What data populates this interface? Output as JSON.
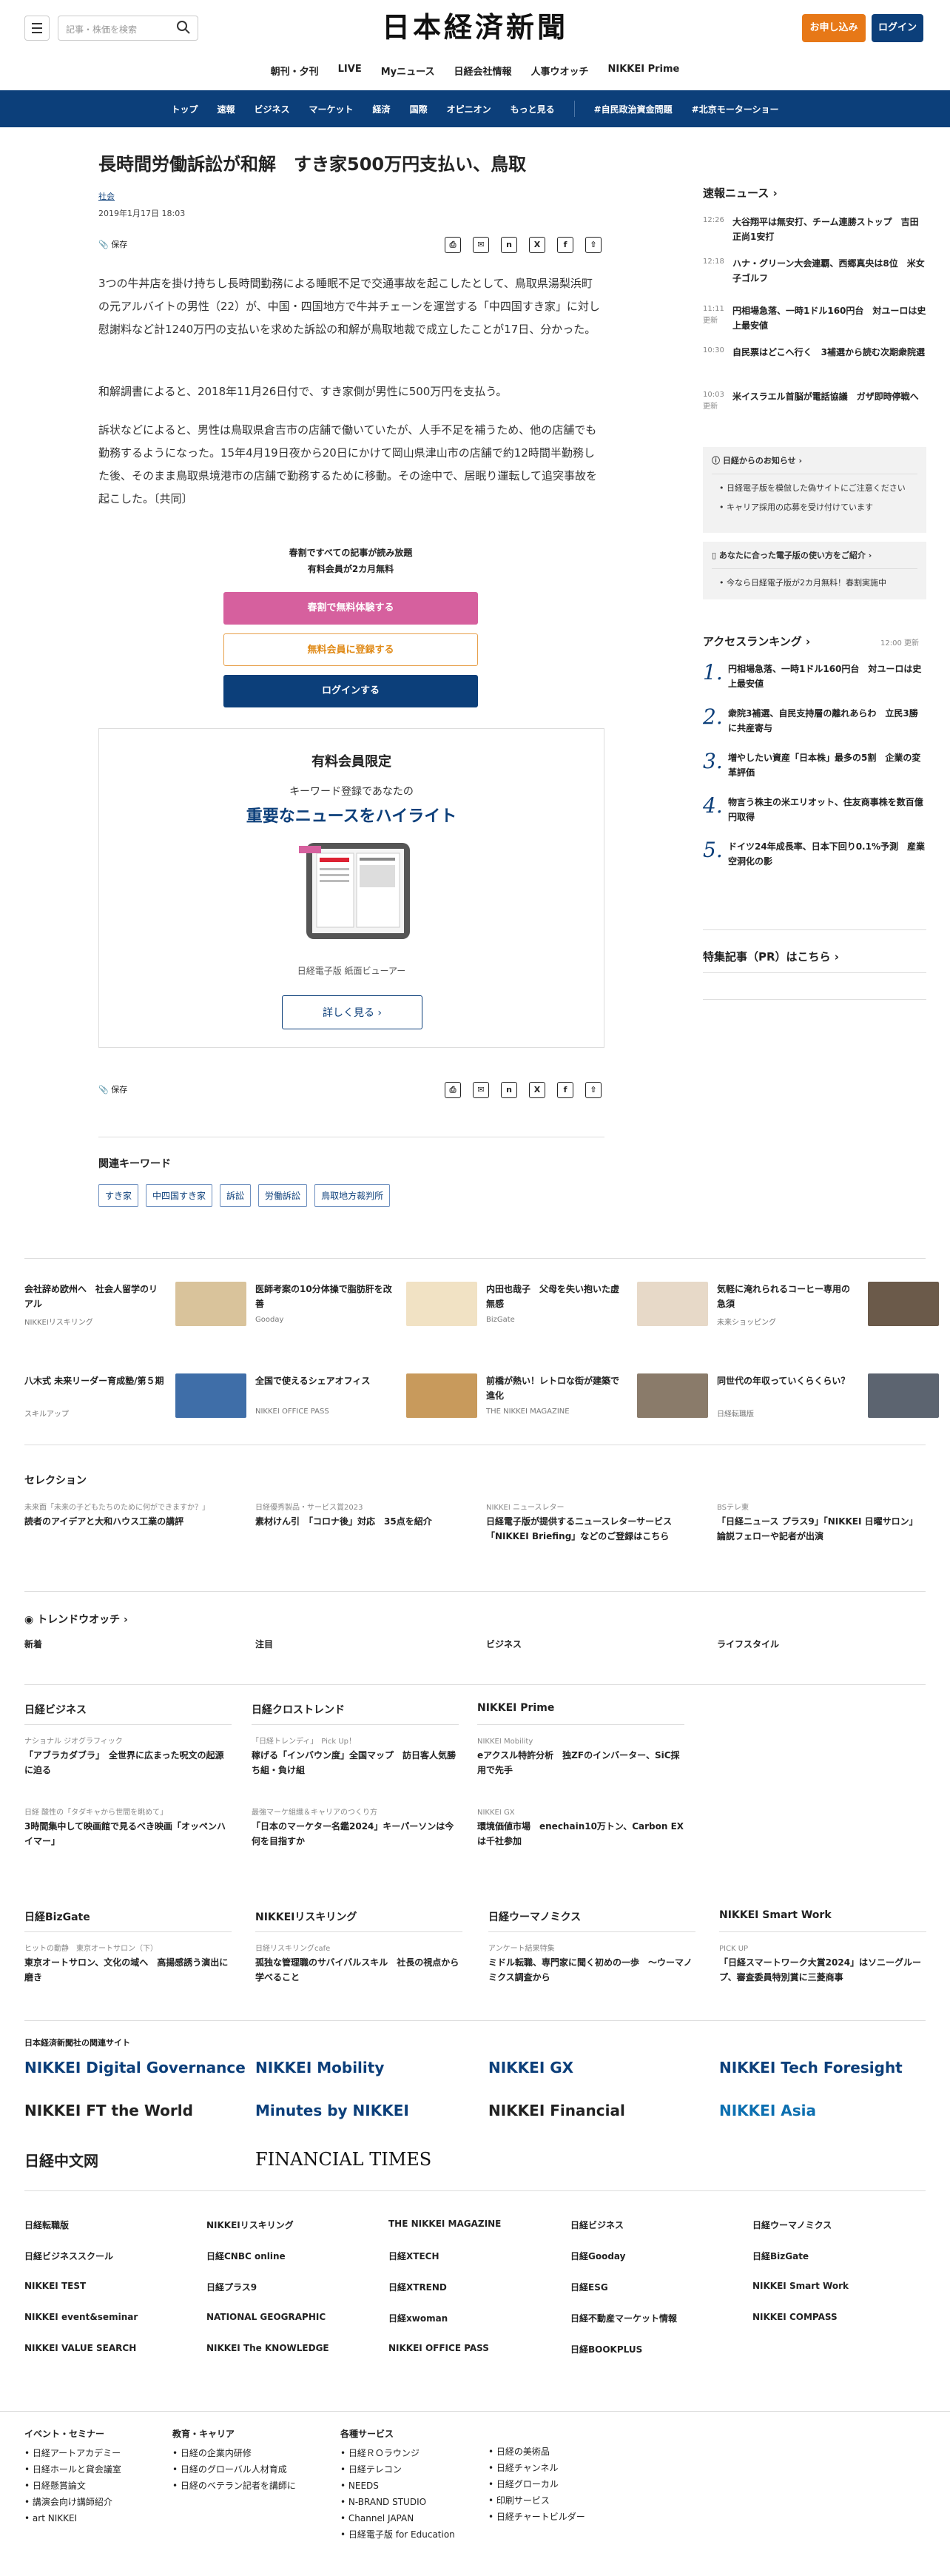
{
  "header": {
    "search_placeholder": "記事・株価を検索",
    "logo": "日本経済新聞",
    "subscribe": "お申し込み",
    "login": "ログイン"
  },
  "subnav": [
    "朝刊・夕刊",
    "LIVE",
    "Myニュース",
    "日経会社情報",
    "人事ウオッチ",
    "NIKKEI Prime"
  ],
  "mainnav": [
    "トップ",
    "速報",
    "ビジネス",
    "マーケット",
    "経済",
    "国際",
    "オピニオン",
    "もっと見る",
    "#自民政治資金問題",
    "#北京モーターショー"
  ],
  "article": {
    "title": "長時間労働訴訟が和解　すき家500万円支払い、鳥取",
    "category": "社会",
    "date": "2019年1月17日 18:03",
    "save": "保存",
    "paragraphs": [
      "3つの牛丼店を掛け持ちし長時間勤務による睡眠不足で交通事故を起こしたとして、鳥取県湯梨浜町の元アルバイトの男性（22）が、中国・四国地方で牛丼チェーンを運営する「中四国すき家」に対し慰謝料など計1240万円の支払いを求めた訴訟の和解が鳥取地裁で成立したことが17日、分かった。",
      "和解調書によると、2018年11月26日付で、すき家側が男性に500万円を支払う。",
      "訴状などによると、男性は鳥取県倉吉市の店舗で働いていたが、人手不足を補うため、他の店舗でも勤務するようになった。15年4月19日夜から20日にかけて岡山県津山市の店舗で約12時間半勤務した後、そのまま鳥取県境港市の店舗で勤務するために移動。その途中で、居眠り運転して追突事故を起こした。〔共同〕"
    ]
  },
  "paywall": {
    "line1": "春割ですべての記事が読み放題",
    "line2": "有料会員が2カ月無料",
    "btn_trial": "春割で無料体験する",
    "btn_register": "無料会員に登録する",
    "btn_login": "ログインする"
  },
  "premium": {
    "title": "有料会員限定",
    "line1": "キーワード登録であなたの",
    "line2": "重要なニュースをハイライト",
    "caption": "日経電子版 紙面ビューアー",
    "more": "詳しく見る"
  },
  "keywords": {
    "title": "関連キーワード",
    "items": [
      "すき家",
      "中四国すき家",
      "訴訟",
      "労働訴訟",
      "鳥取地方裁判所"
    ]
  },
  "breaking": {
    "title": "速報ニュース",
    "items": [
      {
        "time": "12:26",
        "text": "大谷翔平は無安打、チーム連勝ストップ　吉田正尚1安打"
      },
      {
        "time": "12:18",
        "text": "ハナ・グリーン大会連覇、西郷真央は8位　米女子ゴルフ"
      },
      {
        "time": "11:11 更新",
        "text": "円相場急落、一時1ドル160円台　対ユーロは史上最安値"
      },
      {
        "time": "10:30",
        "text": "自民票はどこへ行く　3補選から読む次期衆院選"
      },
      {
        "time": "10:03 更新",
        "text": "米イスラエル首脳が電話協議　ガザ即時停戦へ"
      }
    ]
  },
  "notices": {
    "title": "日経からのお知らせ",
    "items": [
      "日経電子版を模倣した偽サイトにご注意ください",
      "キャリア採用の応募を受け付けています"
    ],
    "guide": "あなたに合った電子版の使い方をご紹介",
    "campaign": "今なら日経電子版が2カ月無料！春割実施中"
  },
  "ranking": {
    "title": "アクセスランキング",
    "time": "12:00 更新",
    "items": [
      {
        "rank": "1.",
        "text": "円相場急落、一時1ドル160円台　対ユーロは史上最安値"
      },
      {
        "rank": "2.",
        "text": "衆院3補選、自民支持層の離れあらわ　立民3勝に共産寄与"
      },
      {
        "rank": "3.",
        "text": "増やしたい資産「日本株」最多の5割　企業の変革評価"
      },
      {
        "rank": "4.",
        "text": "物言う株主の米エリオット、住友商事株を数百億円取得"
      },
      {
        "rank": "5.",
        "text": "ドイツ24年成長率、日本下回り0.1%予測　産業空洞化の影"
      }
    ]
  },
  "pr": {
    "title": "特集記事（PR）はこちら"
  },
  "promos": [
    {
      "text": "会社辞め欧州へ　社会人留学のリアル",
      "source": "NIKKEIリスキリング",
      "color": "#d9c39b"
    },
    {
      "text": "医師考案の10分体操で脂肪肝を改善",
      "source": "Gooday",
      "color": "#f1e2c4"
    },
    {
      "text": "内田也哉子　父母を失い抱いた虚無感",
      "source": "BizGate",
      "color": "#e7d9c8"
    },
    {
      "text": "気軽に淹れられるコーヒー専用の急須",
      "source": "未来ショッピング",
      "color": "#6b5a4a"
    },
    {
      "text": "八木式 未来リーダー育成塾/第５期",
      "source": "スキルアップ",
      "color": "#3f6ea8"
    },
    {
      "text": "全国で使えるシェアオフィス",
      "source": "NIKKEI OFFICE PASS",
      "color": "#c89a5c"
    },
    {
      "text": "前橋が熱い！レトロな街が建築で進化",
      "source": "THE NIKKEI MAGAZINE",
      "color": "#8a7b6a"
    },
    {
      "text": "同世代の年収っていくらくらい？",
      "source": "日経転職版",
      "color": "#5c6470"
    }
  ],
  "selection": {
    "title": "セレクション",
    "items": [
      {
        "sub": "未来面「未来の子どもたちのために何ができますか？」",
        "text": "読者のアイデアと大和ハウス工業の講評"
      },
      {
        "sub": "日経優秀製品・サービス賞2023",
        "text": "素材けん引　「コロナ後」対応　35点を紹介"
      },
      {
        "sub": "NIKKEI ニュースレター",
        "text": "日経電子版が提供するニュースレターサービス「NIKKEI Briefing」などのご登録はこちら"
      },
      {
        "sub": "BSテレ東",
        "text": "「日経ニュース プラス9」「NIKKEI 日曜サロン」論説フェローや記者が出演"
      }
    ]
  },
  "trend": {
    "title": "トレンドウオッチ",
    "cols": [
      "新着",
      "注目",
      "ビジネス",
      "ライフスタイル"
    ]
  },
  "blocks": [
    {
      "title": "日経ビジネス",
      "items": [
        {
          "sub": "ナショナル ジオグラフィック",
          "text": "「アブラカダブラ」　全世界に広まった呪文の起源に迫る"
        },
        {
          "sub": "日経 酸性の「タダキャから世間を眺めて」",
          "text": "3時間集中して映画館で見るべき映画「オッペンハイマー」"
        }
      ]
    },
    {
      "title": "日経クロストレンド",
      "items": [
        {
          "sub": "「日経トレンディ」　Pick Up！",
          "text": "稼げる「インバウン度」全国マップ　訪日客人気勝ち組・負け組"
        },
        {
          "sub": "最強マーケ組織＆キャリアのつくり方",
          "text": "「日本のマーケター名鑑2024」キーパーソンは今何を目指すか"
        }
      ]
    },
    {
      "title": "NIKKEI Prime",
      "items": [
        {
          "sub": "NIKKEI Mobility",
          "text": "eアクスル特許分析　独ZFのインバーター、SiC採用で先手"
        },
        {
          "sub": "NIKKEI GX",
          "text": "環境価値市場　enechain10万トン、Carbon EXは千社参加"
        }
      ]
    },
    {
      "title": "日経BizGate",
      "items": [
        {
          "sub": "ヒットの動静　東京オートサロン（下）",
          "text": "東京オートサロン、文化の域へ　高揚感誘う演出に磨き"
        }
      ]
    },
    {
      "title": "NIKKEIリスキリング",
      "items": [
        {
          "sub": "日経リスキリングcafe",
          "text": "孤独な管理職のサバイバルスキル　社長の視点から学べること"
        }
      ]
    },
    {
      "title": "日経ウーマノミクス",
      "items": [
        {
          "sub": "アンケート結果特集",
          "text": "ミドル転職、専門家に聞く初めの一歩　〜ウーマノミクス調査から"
        }
      ]
    },
    {
      "title": "NIKKEI Smart Work",
      "items": [
        {
          "sub": "PICK UP",
          "text": "「日経スマートワーク大賞2024」はソニーグループ、審査委員特別賞に三菱商事"
        }
      ]
    }
  ],
  "related": {
    "title": "日本経済新聞社の関連サイト",
    "sites": [
      "NIKKEI Digital Governance",
      "NIKKEI Mobility",
      "NIKKEI GX",
      "NIKKEI Tech Foresight",
      "NIKKEI FT the World",
      "Minutes by NIKKEI",
      "NIKKEI Financial",
      "NIKKEI Asia",
      "日経中文网",
      "FINANCIAL TIMES"
    ]
  },
  "brands": [
    "日経転職版",
    "NIKKEIリスキリング",
    "THE NIKKEI MAGAZINE",
    "日経ビジネス",
    "日経ウーマノミクス",
    "日経ビジネススクール",
    "日経CNBC online",
    "日経XTECH",
    "日経Gooday",
    "日経BizGate",
    "NIKKEI TEST",
    "日経プラス9",
    "日経XTREND",
    "日経ESG",
    "NIKKEI Smart Work",
    "NIKKEI event&seminar",
    "NATIONAL GEOGRAPHIC",
    "日経xwoman",
    "日経不動産マーケット情報",
    "NIKKEI COMPASS",
    "NIKKEI VALUE SEARCH",
    "NIKKEI The KNOWLEDGE",
    "NIKKEI OFFICE PASS",
    "日経BOOKPLUS"
  ],
  "footer": [
    {
      "title": "イベント・セミナー",
      "items": [
        "日経アートアカデミー",
        "日経ホールと貸会議室",
        "日経懸賞論文",
        "講演会向け講師紹介",
        "art NIKKEI"
      ]
    },
    {
      "title": "教育・キャリア",
      "items": [
        "日経の企業内研修",
        "日経のグローバル人材育成",
        "日経のベテラン記者を講師に"
      ]
    },
    {
      "title": "各種サービス",
      "items": [
        "日経ＲＯラウンジ",
        "日経テレコン",
        "NEEDS",
        "N-BRAND STUDIO",
        "Channel JAPAN",
        "日経電子版 for Education"
      ]
    },
    {
      "title": "",
      "items": [
        "日経の美術品",
        "日経チャンネル",
        "日経グローカル",
        "印刷サービス",
        "日経チャートビルダー"
      ]
    }
  ]
}
